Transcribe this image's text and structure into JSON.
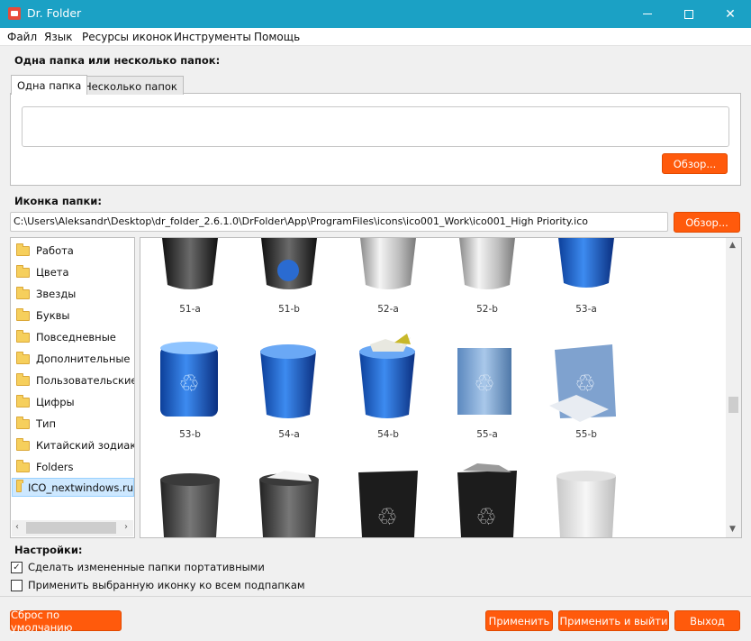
{
  "window": {
    "title": "Dr. Folder"
  },
  "menu": [
    "Файл",
    "Язык",
    "Ресурсы иконок",
    "Инструменты",
    "Помощь"
  ],
  "folders_section": {
    "label": "Одна папка или несколько папок:",
    "tabs": [
      "Одна папка",
      "Несколько папок"
    ],
    "active_tab": "Одна папка",
    "browse_label": "Обзор..."
  },
  "icon_section": {
    "label": "Иконка папки:",
    "path": "C:\\Users\\Aleksandr\\Desktop\\dr_folder_2.6.1.0\\DrFolder\\App\\ProgramFiles\\icons\\ico001_Work\\ico001_High Priority.ico",
    "browse_label": "Обзор..."
  },
  "categories": [
    "Работа",
    "Цвета",
    "Звезды",
    "Буквы",
    "Повседневные",
    "Дополнительные",
    "Пользовательские",
    "Цифры",
    "Тип",
    "Китайский зодиак",
    "Folders",
    "ICO_nextwindows.ru"
  ],
  "selected_category": "ICO_nextwindows.ru",
  "icons": [
    "51-a",
    "51-b",
    "52-a",
    "52-b",
    "53-a",
    "53-b",
    "54-a",
    "54-b",
    "55-a",
    "55-b",
    "",
    "",
    "",
    "",
    ""
  ],
  "settings": {
    "label": "Настройки:",
    "options": [
      {
        "label": "Сделать измененные папки портативными",
        "checked": true
      },
      {
        "label": "Применить выбранную иконку ко всем подпапкам",
        "checked": false
      }
    ]
  },
  "buttons": {
    "reset": "Сброс по умолчанию",
    "apply": "Применить",
    "apply_exit": "Применить и выйти",
    "exit": "Выход"
  }
}
